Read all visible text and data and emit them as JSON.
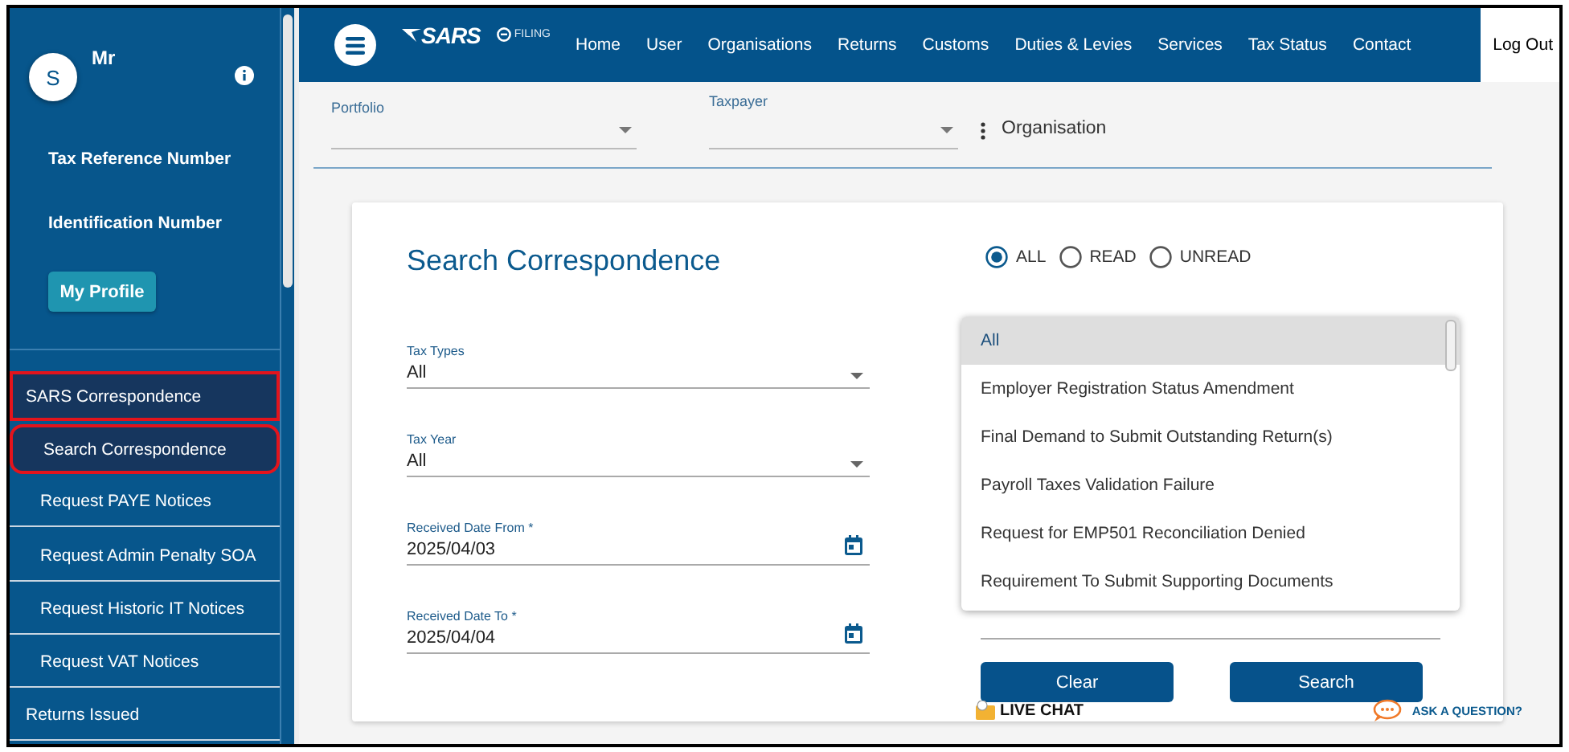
{
  "sidebar": {
    "avatar": "S",
    "user_name": "Mr",
    "fields": [
      "Tax Reference Number",
      "Identification Number"
    ],
    "profile_button": "My Profile",
    "items": [
      {
        "label": "SARS Correspondence",
        "kind": "section",
        "selected": true,
        "highlighted": true
      },
      {
        "label": "Search Correspondence",
        "kind": "sub",
        "selected": true,
        "highlighted": true
      },
      {
        "label": "Request PAYE Notices",
        "kind": "sub",
        "selected": false,
        "highlighted": false
      },
      {
        "label": "Request Admin Penalty SOA",
        "kind": "sub",
        "selected": false,
        "highlighted": false
      },
      {
        "label": "Request Historic IT Notices",
        "kind": "sub",
        "selected": false,
        "highlighted": false
      },
      {
        "label": "Request VAT Notices",
        "kind": "sub",
        "selected": false,
        "highlighted": false
      },
      {
        "label": "Returns Issued",
        "kind": "section",
        "selected": false,
        "highlighted": false
      }
    ]
  },
  "topbar": {
    "logo": "SARS",
    "logo_sub": "FILING",
    "nav": [
      "Home",
      "User",
      "Organisations",
      "Returns",
      "Customs",
      "Duties & Levies",
      "Services",
      "Tax Status",
      "Contact"
    ],
    "logout": "Log Out"
  },
  "selectors": [
    {
      "label": "Portfolio"
    },
    {
      "label": "Taxpayer"
    }
  ],
  "organisation": "Organisation",
  "search": {
    "title": "Search Correspondence",
    "filter": [
      {
        "label": "ALL",
        "selected": true
      },
      {
        "label": "READ",
        "selected": false
      },
      {
        "label": "UNREAD",
        "selected": false
      }
    ],
    "fields": [
      {
        "label": "Tax Types",
        "value": "All",
        "kind": "select"
      },
      {
        "label": "Tax Year",
        "value": "All",
        "kind": "select"
      },
      {
        "label": "Received Date From *",
        "value": "2025/04/03",
        "kind": "date"
      },
      {
        "label": "Received Date To *",
        "value": "2025/04/04",
        "kind": "date"
      }
    ],
    "letter_type_options": [
      {
        "label": "All",
        "selected": true
      },
      {
        "label": "Employer Registration Status Amendment",
        "selected": false
      },
      {
        "label": "Final Demand to Submit Outstanding Return(s)",
        "selected": false
      },
      {
        "label": "Payroll Taxes Validation Failure",
        "selected": false
      },
      {
        "label": "Request for EMP501 Reconciliation Denied",
        "selected": false
      },
      {
        "label": "Requirement To Submit Supporting Documents",
        "selected": false
      }
    ],
    "buttons": [
      "Clear",
      "Search"
    ]
  },
  "live_chat": "LIVE CHAT",
  "ask_question": "ASK A QUESTION?"
}
